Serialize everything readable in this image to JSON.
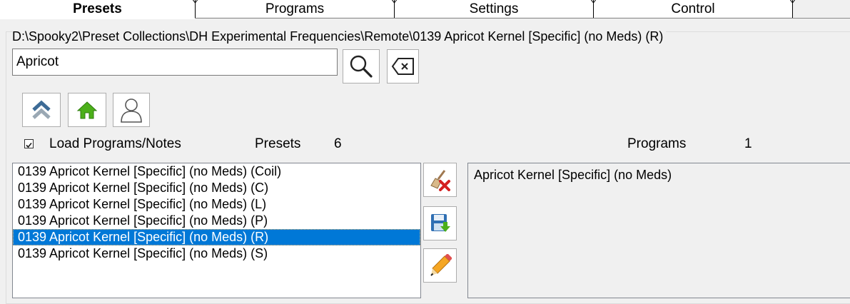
{
  "tabs": [
    {
      "label": "Presets",
      "active": true
    },
    {
      "label": "Programs",
      "active": false
    },
    {
      "label": "Settings",
      "active": false
    },
    {
      "label": "Control",
      "active": false
    }
  ],
  "path": "D:\\Spooky2\\Preset Collections\\DH Experimental Frequencies\\Remote\\0139 Apricot Kernel [Specific] (no Meds) (R)",
  "search": {
    "value": "Apricot"
  },
  "icons": {
    "search": "magnifier-icon",
    "clear": "backspace-icon",
    "up": "double-chevron-up-icon",
    "home": "home-icon",
    "user": "user-icon",
    "delete": "broom-delete-icon",
    "save": "save-icon",
    "edit": "pencil-icon"
  },
  "options": {
    "load_programs_label": "Load Programs/Notes",
    "load_programs_checked": true
  },
  "presets": {
    "label": "Presets",
    "count": "6",
    "items": [
      "0139 Apricot Kernel [Specific] (no Meds) (Coil)",
      "0139 Apricot Kernel [Specific] (no Meds) (C)",
      "0139 Apricot Kernel [Specific] (no Meds) (L)",
      "0139 Apricot Kernel [Specific] (no Meds) (P)",
      "0139 Apricot Kernel [Specific] (no Meds) (R)",
      "0139 Apricot Kernel [Specific] (no Meds) (S)"
    ],
    "selected_index": 4
  },
  "programs": {
    "label": "Programs",
    "count": "1",
    "items": [
      "Apricot Kernel [Specific] (no Meds)"
    ]
  },
  "colors": {
    "selection": "#0078d7",
    "home_green": "#4caf1a",
    "delete_red": "#d42020"
  }
}
